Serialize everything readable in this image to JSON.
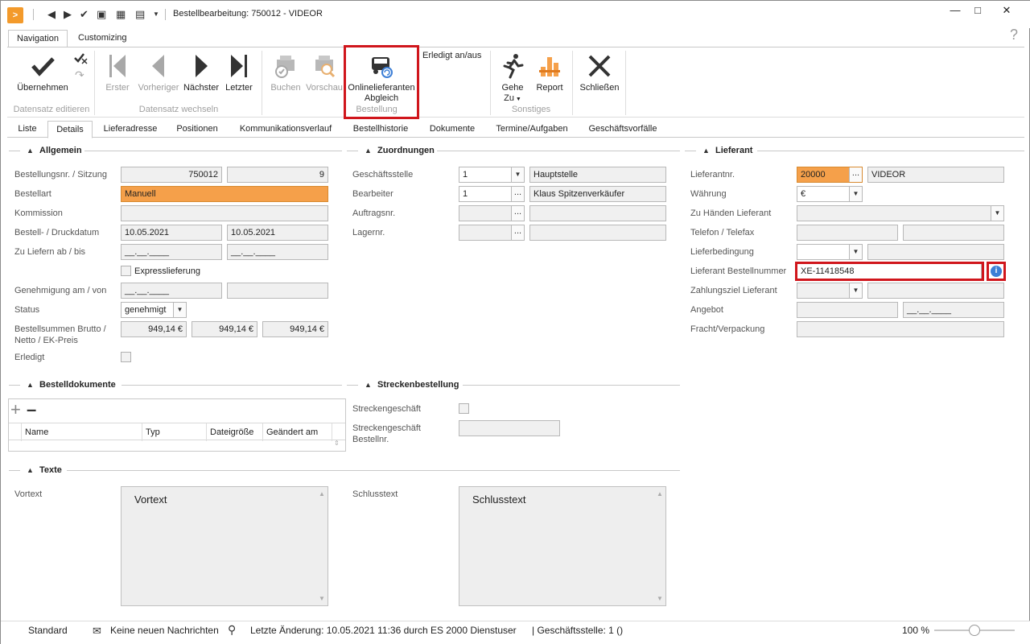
{
  "window": {
    "title": "Bestellbearbeitung: 750012 - VIDEOR",
    "help": "?"
  },
  "ribbon_tabs": [
    "Navigation",
    "Customizing"
  ],
  "ribbon": {
    "uebernehmen": "Übernehmen",
    "erster": "Erster",
    "vorheriger": "Vorheriger",
    "naechster": "Nächster",
    "letzter": "Letzter",
    "buchen": "Buchen",
    "vorschau": "Vorschau",
    "online_line1": "Onlinelieferanten",
    "online_line2": "Abgleich",
    "erledigt": "Erledigt an/aus",
    "gehe_line1": "Gehe",
    "gehe_line2": "Zu",
    "report": "Report",
    "schliessen": "Schließen",
    "groups": {
      "datensatz_editieren": "Datensatz editieren",
      "datensatz_wechseln": "Datensatz wechseln",
      "bestellung": "Bestellung",
      "sonstiges": "Sonstiges"
    }
  },
  "tabs": [
    "Liste",
    "Details",
    "Lieferadresse",
    "Positionen",
    "Kommunikationsverlauf",
    "Bestellhistorie",
    "Dokumente",
    "Termine/Aufgaben",
    "Geschäftsvorfälle"
  ],
  "allgemein": {
    "title": "Allgemein",
    "bestellnr_label": "Bestellungsnr. / Sitzung",
    "bestellnr": "750012",
    "sitzung": "9",
    "bestellart_label": "Bestellart",
    "bestellart": "Manuell",
    "kommission_label": "Kommission",
    "druckdatum_label": "Bestell- / Druckdatum",
    "bestelldatum": "10.05.2021",
    "druckdatum": "10.05.2021",
    "liefern_label": "Zu Liefern ab / bis",
    "liefern_ab": "__.__.____",
    "liefern_bis": "__.__.____",
    "express_label": "Expresslieferung",
    "genehmigung_label": "Genehmigung am / von",
    "genehmigung_am": "__.__.____",
    "status_label": "Status",
    "status": "genehmigt",
    "summen_label_1": "Bestellsummen Brutto /",
    "summen_label_2": "Netto / EK-Preis",
    "brutto": "949,14 €",
    "netto": "949,14 €",
    "ek": "949,14 €",
    "erledigt_label": "Erledigt"
  },
  "zuordnungen": {
    "title": "Zuordnungen",
    "geschaeftsstelle_label": "Geschäftsstelle",
    "geschaeftsstelle_nr": "1",
    "geschaeftsstelle": "Hauptstelle",
    "bearbeiter_label": "Bearbeiter",
    "bearbeiter_nr": "1",
    "bearbeiter": "Klaus Spitzenverkäufer",
    "auftragsnr_label": "Auftragsnr.",
    "lagernr_label": "Lagernr."
  },
  "lieferant": {
    "title": "Lieferant",
    "lieferantnr_label": "Lieferantnr.",
    "lieferantnr": "20000",
    "name": "VIDEOR",
    "waehrung_label": "Währung",
    "waehrung": "€",
    "zu_haenden_label": "Zu Händen Lieferant",
    "telefon_label": "Telefon / Telefax",
    "lieferbedingung_label": "Lieferbedingung",
    "bestellnummer_label": "Lieferant Bestellnummer",
    "bestellnummer": "XE-11418548",
    "zahlungsziel_label": "Zahlungsziel Lieferant",
    "angebot_label": "Angebot",
    "angebot_datum": "__.__.____",
    "fracht_label": "Fracht/Verpackung"
  },
  "bestelldokumente": {
    "title": "Bestelldokumente",
    "columns": [
      "Name",
      "Typ",
      "Dateigröße",
      "Geändert am"
    ]
  },
  "streckenbestellung": {
    "title": "Streckenbestellung",
    "geschaeft_label": "Streckengeschäft",
    "bestellnr_label_1": "Streckengeschäft",
    "bestellnr_label_2": "Bestellnr."
  },
  "texte": {
    "title": "Texte",
    "vortext_label": "Vortext",
    "vortext": "Vortext",
    "schlusstext_label": "Schlusstext",
    "schlusstext": "Schlusstext"
  },
  "statusbar": {
    "standard": "Standard",
    "nachrichten": "Keine neuen Nachrichten",
    "letzte_aenderung": "Letzte Änderung: 10.05.2021 11:36 durch ES 2000 Dienstuser",
    "geschaeftsstelle": "| Geschäftsstelle:  1 ()",
    "zoom": "100 %"
  }
}
